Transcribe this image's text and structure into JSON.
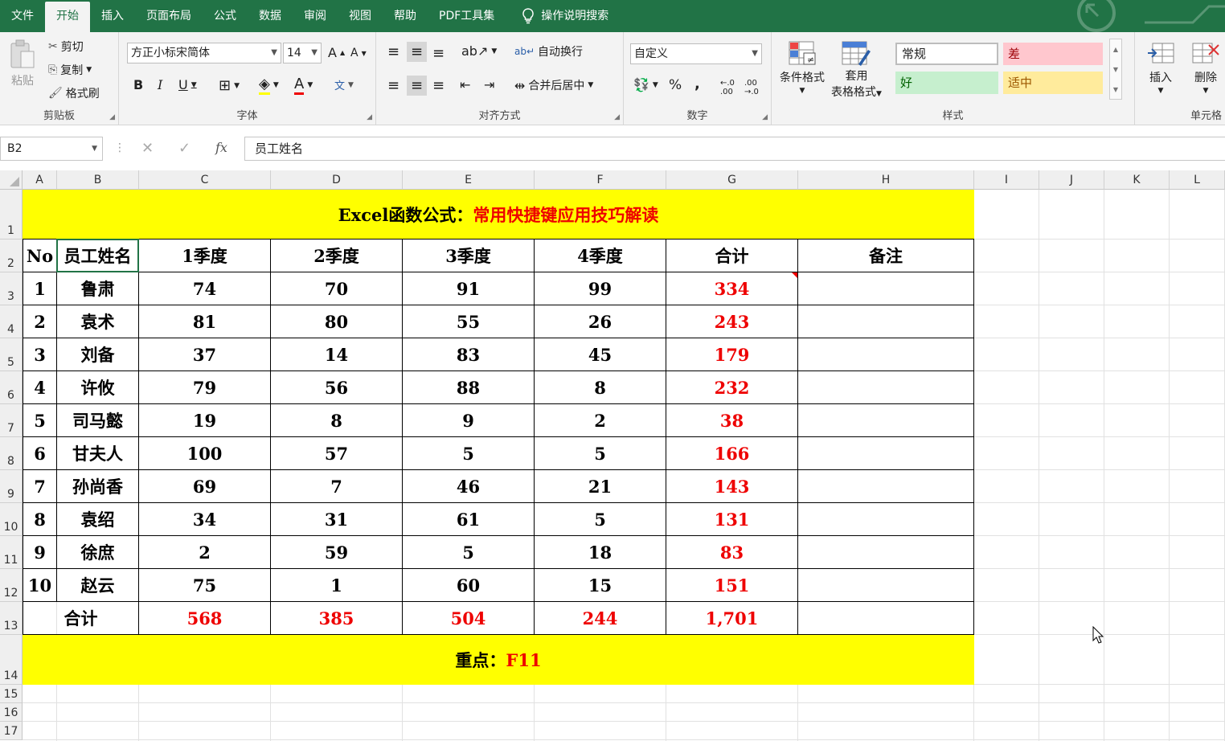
{
  "tabs": [
    "文件",
    "开始",
    "插入",
    "页面布局",
    "公式",
    "数据",
    "审阅",
    "视图",
    "帮助",
    "PDF工具集"
  ],
  "tell_me": "操作说明搜索",
  "clipboard": {
    "paste": "粘贴",
    "cut": "剪切",
    "copy": "复制",
    "format_painter": "格式刷",
    "label": "剪贴板"
  },
  "font": {
    "name": "方正小标宋简体",
    "size": "14",
    "label": "字体"
  },
  "alignment": {
    "wrap": "自动换行",
    "merge": "合并后居中",
    "label": "对齐方式"
  },
  "number": {
    "format": "自定义",
    "label": "数字"
  },
  "styles": {
    "conditional": "条件格式",
    "table_fmt_1": "套用",
    "table_fmt_2": "表格格式",
    "normal": "常规",
    "bad": "差",
    "good": "好",
    "neutral": "适中",
    "label": "样式"
  },
  "cells": {
    "insert": "插入",
    "delete": "删除",
    "label": "单元格"
  },
  "formula_bar": {
    "name_box": "B2",
    "fx": "fx",
    "content": "员工姓名"
  },
  "columns": [
    "A",
    "B",
    "C",
    "D",
    "E",
    "F",
    "G",
    "H",
    "I",
    "J",
    "K",
    "L"
  ],
  "rows": [
    "1",
    "2",
    "3",
    "4",
    "5",
    "6",
    "7",
    "8",
    "9",
    "10",
    "11",
    "12",
    "13",
    "14",
    "15",
    "16",
    "17"
  ],
  "sheet": {
    "title_black": "Excel函数公式：",
    "title_red": "常用快捷键应用技巧解读",
    "headers": [
      "No",
      "员工姓名",
      "1季度",
      "2季度",
      "3季度",
      "4季度",
      "合计",
      "备注"
    ],
    "records": [
      [
        "1",
        "鲁肃",
        "74",
        "70",
        "91",
        "99",
        "334"
      ],
      [
        "2",
        "袁术",
        "81",
        "80",
        "55",
        "26",
        "243"
      ],
      [
        "3",
        "刘备",
        "37",
        "14",
        "83",
        "45",
        "179"
      ],
      [
        "4",
        "许攸",
        "79",
        "56",
        "88",
        "8",
        "232"
      ],
      [
        "5",
        "司马懿",
        "19",
        "8",
        "9",
        "2",
        "38"
      ],
      [
        "6",
        "甘夫人",
        "100",
        "57",
        "5",
        "5",
        "166"
      ],
      [
        "7",
        "孙尚香",
        "69",
        "7",
        "46",
        "21",
        "143"
      ],
      [
        "8",
        "袁绍",
        "34",
        "31",
        "61",
        "5",
        "131"
      ],
      [
        "9",
        "徐庶",
        "2",
        "59",
        "5",
        "18",
        "83"
      ],
      [
        "10",
        "赵云",
        "75",
        "1",
        "60",
        "15",
        "151"
      ]
    ],
    "total_label": "合计",
    "totals": [
      "568",
      "385",
      "504",
      "244",
      "1,701"
    ],
    "footer_black": "重点：",
    "footer_red": "F11"
  },
  "colors": {
    "accent": "#217346",
    "highlight": "#ffff00",
    "red": "#ee0000"
  }
}
